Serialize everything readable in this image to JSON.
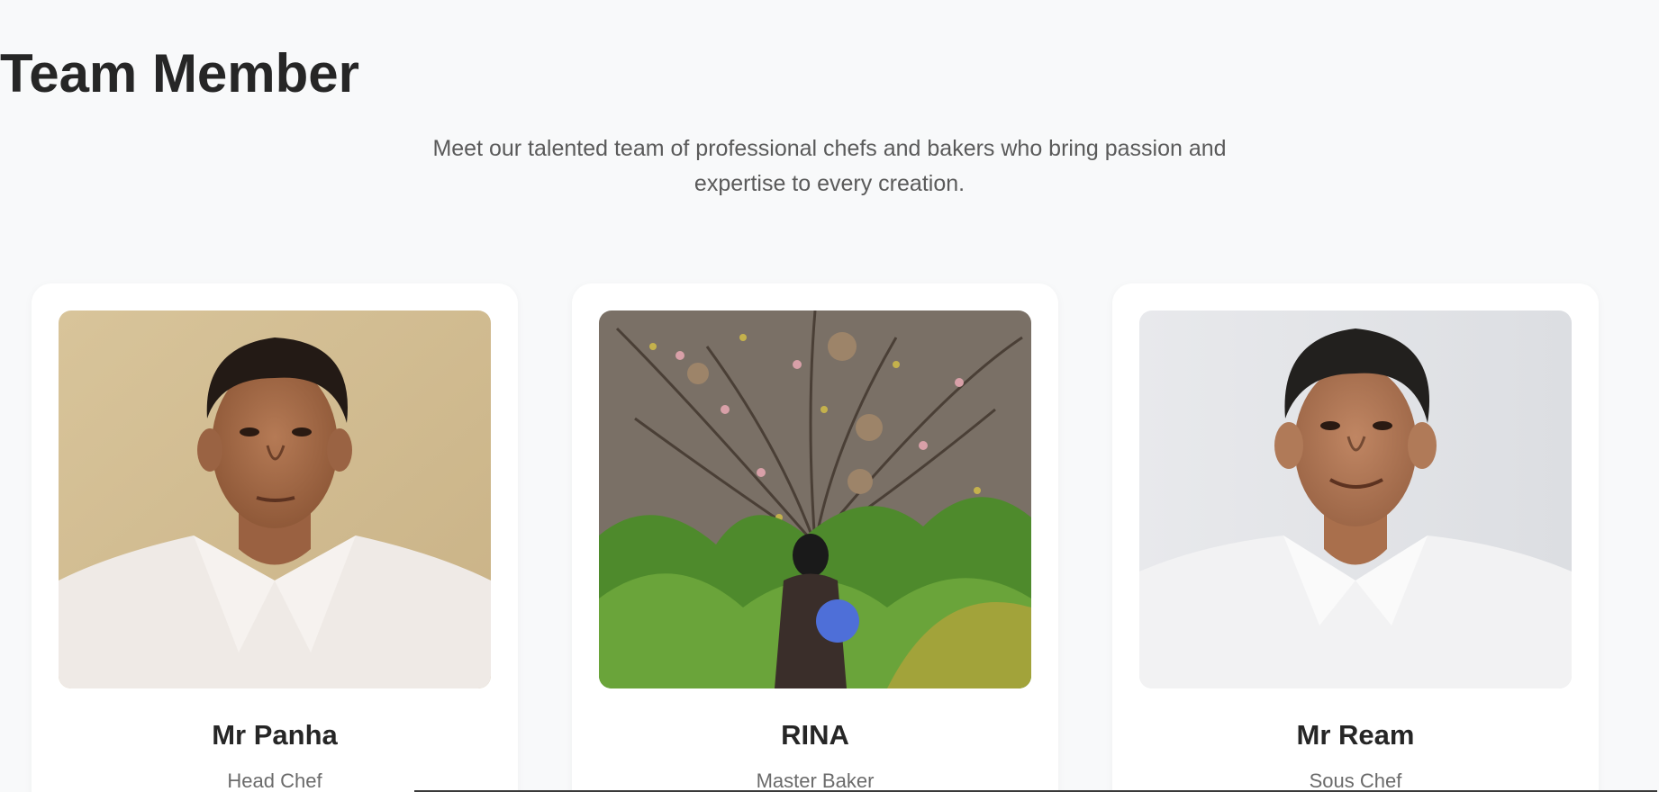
{
  "section": {
    "title": "Team Member",
    "subtitle": "Meet our talented team of professional chefs and bakers who bring passion and expertise to every creation."
  },
  "members": [
    {
      "name": "Mr Panha",
      "role": "Head Chef",
      "photo": "portrait-photo"
    },
    {
      "name": "RINA",
      "role": "Master Baker",
      "photo": "outdoor-tree-photo"
    },
    {
      "name": "Mr Ream",
      "role": "Sous Chef",
      "photo": "portrait-photo"
    }
  ],
  "colors": {
    "background": "#f8f9fa",
    "card": "#ffffff",
    "heading": "#262626",
    "subtext": "#5a5a5a"
  }
}
